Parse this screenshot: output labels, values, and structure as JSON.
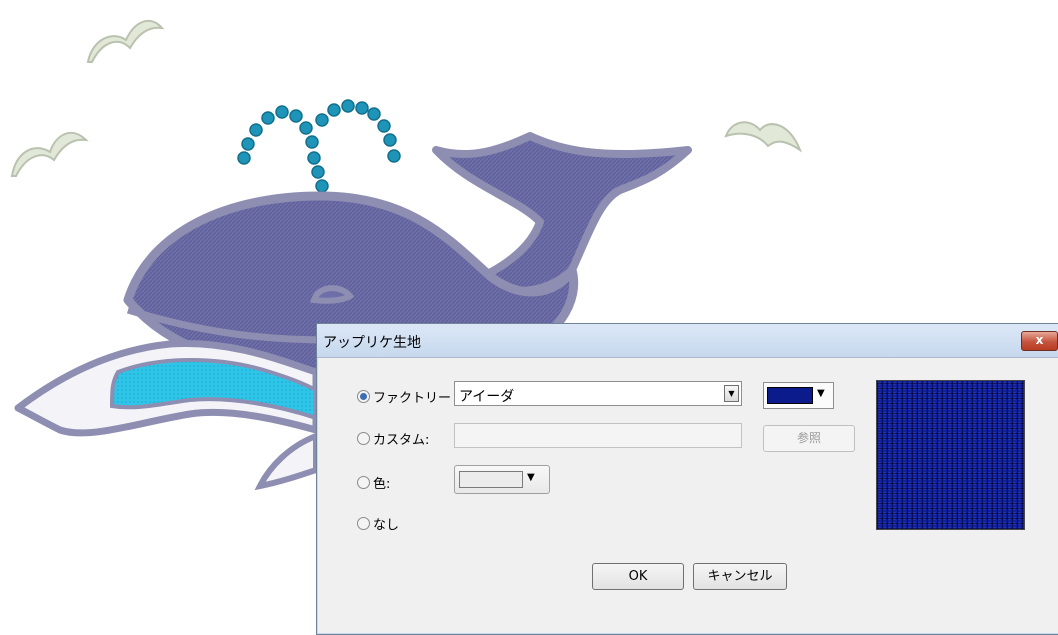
{
  "dialog": {
    "title": "アップリケ生地",
    "close_label": "x",
    "options": {
      "factory_label": "ファクトリー",
      "custom_label": "カスタム:",
      "color_label": "色:",
      "none_label": "なし"
    },
    "selected_option": "factory",
    "fabric_value": "アイーダ",
    "fabric_color": "#0c1b8c",
    "custom_path_value": "",
    "browse_label": "参照",
    "color_value": "#ececec",
    "ok_label": "OK",
    "cancel_label": "キャンセル"
  },
  "design": {
    "whale_color": "#6e6ea8",
    "water_color": "#2ec5e8",
    "spout_color": "#1e95b8",
    "bird_color": "#e2e8d8"
  }
}
